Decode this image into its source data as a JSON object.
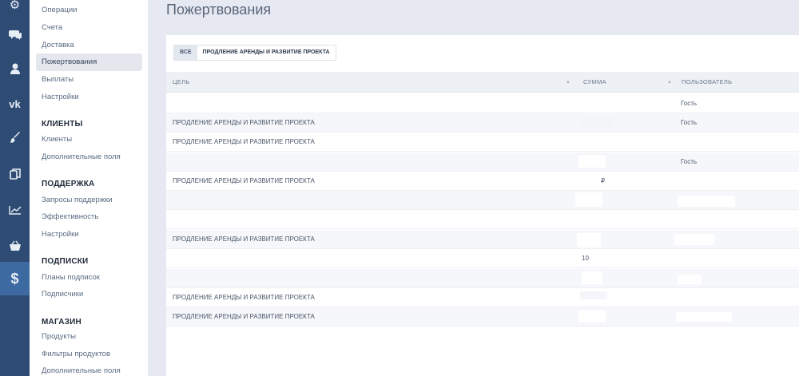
{
  "iconbar": {
    "icons": [
      {
        "name": "settings-icon",
        "glyph": "⚙"
      },
      {
        "name": "chat-icon",
        "glyph": "💬"
      },
      {
        "name": "user-icon",
        "glyph": "👤"
      },
      {
        "name": "vk-icon",
        "glyph": "vk"
      },
      {
        "name": "brush-icon",
        "glyph": "✎"
      },
      {
        "name": "copy-icon",
        "glyph": "⧉"
      },
      {
        "name": "chart-icon",
        "glyph": "↗"
      },
      {
        "name": "basket-icon",
        "glyph": "⌂"
      },
      {
        "name": "dollar-icon",
        "glyph": "$"
      }
    ]
  },
  "menu": {
    "finance_items": [
      "Операции",
      "Счета",
      "Доставка",
      "Пожертвования",
      "Выплаты",
      "Настройки"
    ],
    "clients_header": "КЛИЕНТЫ",
    "clients_items": [
      "Клиенты",
      "Дополнительные поля"
    ],
    "support_header": "ПОДДЕРЖКА",
    "support_items": [
      "Запросы поддержки",
      "Эффективность",
      "Настройки"
    ],
    "subs_header": "ПОДПИСКИ",
    "subs_items": [
      "Планы подписок",
      "Подписчики"
    ],
    "shop_header": "МАГАЗИН",
    "shop_items": [
      "Продукты",
      "Фильтры продуктов",
      "Дополнительные поля"
    ]
  },
  "page": {
    "title": "Пожертвования"
  },
  "tabs": {
    "all": "ВСЕ",
    "project": "ПРОДЛЕНИЕ АРЕНДЫ И РАЗВИТИЕ ПРОЕКТА"
  },
  "table": {
    "headers": {
      "goal": "ЦЕЛЬ",
      "amount": "СУММА",
      "user": "ПОЛЬЗОВАТЕЛЬ"
    },
    "rows": [
      {
        "goal": "",
        "amount": "",
        "user": "Гость"
      },
      {
        "goal": "ПРОДЛЕНИЕ АРЕНДЫ И РАЗВИТИЕ ПРОЕКТА",
        "amount": "",
        "user": "Гость"
      },
      {
        "goal": "ПРОДЛЕНИЕ АРЕНДЫ И РАЗВИТИЕ ПРОЕКТА",
        "amount": "",
        "user": ""
      },
      {
        "goal": "",
        "amount": "",
        "user": "Гость"
      },
      {
        "goal": "ПРОДЛЕНИЕ АРЕНДЫ И РАЗВИТИЕ ПРОЕКТА",
        "amount": "₽",
        "user": ""
      },
      {
        "goal": "",
        "amount": "",
        "user": ""
      },
      {
        "goal": "",
        "amount": "",
        "user": ""
      },
      {
        "goal": "ПРОДЛЕНИЕ АРЕНДЫ И РАЗВИТИЕ ПРОЕКТА",
        "amount": "",
        "user": ""
      },
      {
        "goal": "",
        "amount": "10",
        "user": ""
      },
      {
        "goal": "",
        "amount": "",
        "user": ""
      },
      {
        "goal": "ПРОДЛЕНИЕ АРЕНДЫ И РАЗВИТИЕ ПРОЕКТА",
        "amount": "",
        "user": ""
      },
      {
        "goal": "ПРОДЛЕНИЕ АРЕНДЫ И РАЗВИТИЕ ПРОЕКТА",
        "amount": "",
        "user": ""
      }
    ]
  }
}
